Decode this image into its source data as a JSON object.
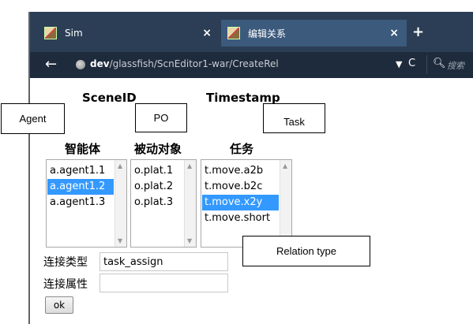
{
  "browser": {
    "tabs": [
      {
        "label": "Sim",
        "close": "×",
        "active": false
      },
      {
        "label": "编辑关系",
        "close": "×",
        "active": true
      }
    ],
    "new_tab": "+",
    "back": "←",
    "url_domain": "dev",
    "url_path": "/glassfish/ScnEditor1-war/CreateRel",
    "dropdown": "▼",
    "reload": "C",
    "search_placeholder": "搜索"
  },
  "page": {
    "scene_header": "SceneID",
    "timestamp_header": "Timestamp",
    "columns": {
      "agent_title": "智能体",
      "po_title": "被动对象",
      "task_title": "任务"
    },
    "agent_list": [
      {
        "label": "a.agent1.1",
        "selected": false
      },
      {
        "label": "a.agent1.2",
        "selected": true
      },
      {
        "label": "a.agent1.3",
        "selected": false
      }
    ],
    "po_list": [
      {
        "label": "o.plat.1",
        "selected": false
      },
      {
        "label": "o.plat.2",
        "selected": false
      },
      {
        "label": "o.plat.3",
        "selected": false
      }
    ],
    "task_list": [
      {
        "label": "t.move.a2b",
        "selected": false
      },
      {
        "label": "t.move.b2c",
        "selected": false
      },
      {
        "label": "t.move.x2y",
        "selected": true
      },
      {
        "label": "t.move.short",
        "selected": false
      }
    ],
    "relation_type_label": "连接类型",
    "relation_type_value": "task_assign",
    "relation_attr_label": "连接属性",
    "relation_attr_value": "",
    "ok_label": "ok"
  },
  "annotations": {
    "agent": "Agent",
    "po": "PO",
    "task": "Task",
    "relation_type": "Relation type"
  },
  "colors": {
    "chrome_bg": "#2c3e55",
    "active_tab": "#3b5a7c",
    "selection": "#3399ff"
  }
}
